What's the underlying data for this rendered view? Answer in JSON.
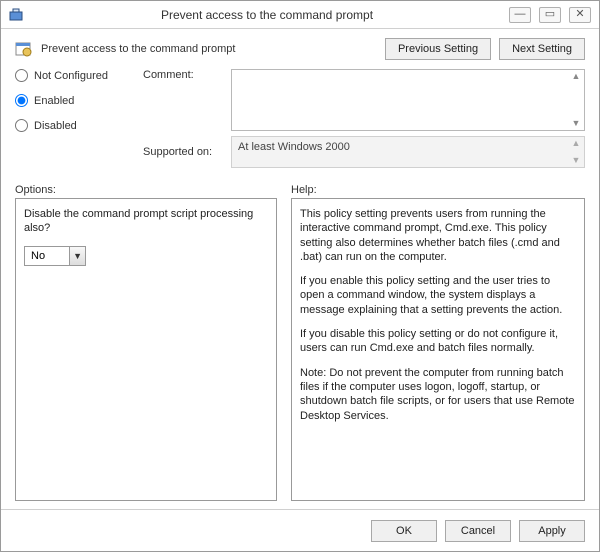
{
  "titlebar": {
    "title": "Prevent access to the command prompt"
  },
  "header": {
    "policy_title": "Prevent access to the command prompt",
    "prev_btn": "Previous Setting",
    "next_btn": "Next Setting"
  },
  "state": {
    "not_configured": "Not Configured",
    "enabled": "Enabled",
    "disabled": "Disabled",
    "selected": "enabled"
  },
  "labels": {
    "comment": "Comment:",
    "supported": "Supported on:",
    "options": "Options:",
    "help": "Help:"
  },
  "comment_value": "",
  "supported_value": "At least Windows 2000",
  "options": {
    "question": "Disable the command prompt script processing also?",
    "dropdown_value": "No"
  },
  "help": {
    "p1": "This policy setting prevents users from running the interactive command prompt, Cmd.exe.  This policy setting also determines whether batch files (.cmd and .bat) can run on the computer.",
    "p2": "If you enable this policy setting and the user tries to open a command window, the system displays a message explaining that a setting prevents the action.",
    "p3": "If you disable this policy setting or do not configure it, users can run Cmd.exe and batch files normally.",
    "p4": "Note: Do not prevent the computer from running batch files if the computer uses logon, logoff, startup, or shutdown batch file scripts, or for users that use Remote Desktop Services."
  },
  "footer": {
    "ok": "OK",
    "cancel": "Cancel",
    "apply": "Apply"
  }
}
